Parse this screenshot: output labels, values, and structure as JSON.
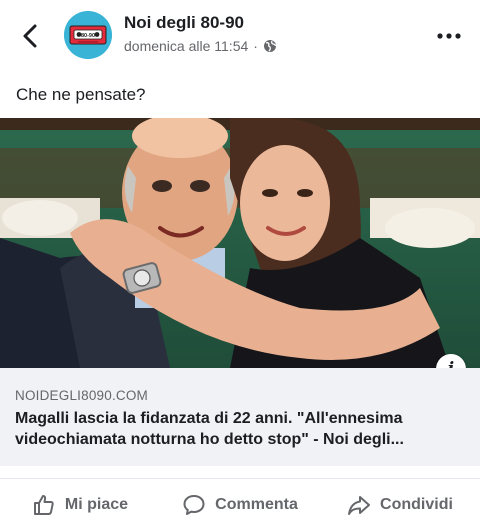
{
  "post": {
    "page_name": "Noi degli 80-90",
    "timestamp": "domenica alle 11:54",
    "separator": "·",
    "audience_icon": "globe-icon",
    "avatar_text": "80-90",
    "caption": "Che ne pensate?"
  },
  "link_preview": {
    "domain": "NOIDEGLI8090.COM",
    "title": "Magalli lascia la fidanzata di 22 anni. \"All'ennesima videochiamata notturna ho detto stop\" - Noi degli...",
    "info_icon": "i"
  },
  "actions": {
    "like": "Mi piace",
    "comment": "Commenta",
    "share": "Condividi"
  },
  "colors": {
    "text": "#1c1e21",
    "secondary": "#65676b",
    "link_bg": "#f0f2f5",
    "avatar_bg": "#3ab4d6"
  }
}
